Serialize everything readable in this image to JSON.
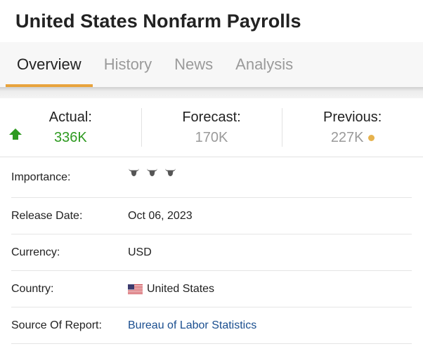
{
  "page": {
    "title": "United States Nonfarm Payrolls"
  },
  "tabs": [
    {
      "label": "Overview",
      "active": true
    },
    {
      "label": "History",
      "active": false
    },
    {
      "label": "News",
      "active": false
    },
    {
      "label": "Analysis",
      "active": false
    }
  ],
  "stats": {
    "actual": {
      "label": "Actual:",
      "value": "336K",
      "trend_icon": "arrow-up-icon",
      "color": "#2e9a20"
    },
    "forecast": {
      "label": "Forecast:",
      "value": "170K"
    },
    "previous": {
      "label": "Previous:",
      "value": "227K",
      "status_dot_color": "#e6b24d"
    }
  },
  "details": {
    "importance": {
      "label": "Importance:",
      "icon": "bull-icon",
      "level": 3,
      "max": 3
    },
    "release_date": {
      "label": "Release Date:",
      "value": "Oct 06, 2023"
    },
    "currency": {
      "label": "Currency:",
      "value": "USD"
    },
    "country": {
      "label": "Country:",
      "value": "United States",
      "icon": "us-flag-icon"
    },
    "source": {
      "label": "Source Of Report:",
      "value": "Bureau of Labor Statistics"
    }
  },
  "colors": {
    "accent": "#e8a33d",
    "link": "#1a4e8f",
    "positive": "#2e9a20"
  }
}
